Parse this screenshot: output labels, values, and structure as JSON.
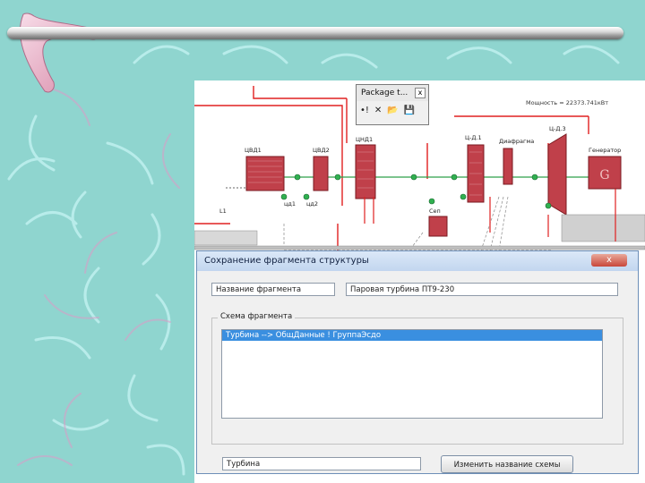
{
  "package_toolbar": {
    "title": "Package t...",
    "close": "x",
    "tools": [
      "•!",
      "✕",
      "📂",
      "💾"
    ]
  },
  "scheme": {
    "header_text": "Мощность = 22373.741кВт",
    "equipment": [
      {
        "id": "cvd1",
        "label": "ЦВД1"
      },
      {
        "id": "cvd2",
        "label": "ЦВД2"
      },
      {
        "id": "cnd1",
        "label": "ЦНД1"
      },
      {
        "id": "cd1",
        "label": "Ц-Д.1"
      },
      {
        "id": "diaphragm",
        "label": "Диафрагма"
      },
      {
        "id": "cd3",
        "label": "Ц-Д.3"
      },
      {
        "id": "generator",
        "label": "Генератор"
      },
      {
        "id": "l1",
        "label": "L1"
      },
      {
        "id": "cd_small1",
        "label": "цд1"
      },
      {
        "id": "cd_small2",
        "label": "цд2"
      },
      {
        "id": "sep",
        "label": "Сеп"
      }
    ],
    "generator_glyph": "G"
  },
  "dialog": {
    "title": "Сохранение фрагмента структуры",
    "close_label": "x",
    "name_label": "Название фрагмента",
    "name_value": "Паровая турбина ПТ9-230",
    "scheme_group_label": "Схема фрагмента",
    "scheme_items": [
      "Турбина --> ОбщДанные ! ГруппаЭсдо"
    ],
    "bottom_field_value": "Турбина",
    "rename_button_label": "Изменить название схемы"
  },
  "colors": {
    "background": "#8fd5cf",
    "accent_pipe_red": "#e02020",
    "selection": "#3a8fe0"
  }
}
